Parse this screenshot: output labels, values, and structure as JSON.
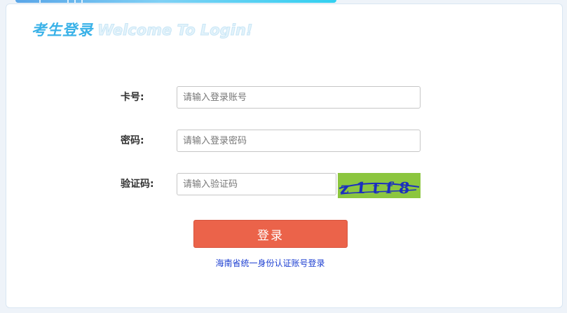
{
  "header": {
    "title_zh": "考生登录",
    "title_en": "Welcome To Login!"
  },
  "form": {
    "card_number": {
      "label": "卡号:",
      "placeholder": "请输入登录账号",
      "value": ""
    },
    "password": {
      "label": "密码:",
      "placeholder": "请输入登录密码",
      "value": ""
    },
    "captcha": {
      "label": "验证码:",
      "placeholder": "请输入验证码",
      "value": "",
      "image_text": "z1tf8"
    }
  },
  "actions": {
    "login_label": "登录",
    "alt_login_link": "海南省统一身份认证账号登录"
  },
  "colors": {
    "accent": "#3ab2e8",
    "login_button": "#eb634a",
    "link": "#1d3fd1",
    "captcha_bg": "#8cc63f"
  }
}
